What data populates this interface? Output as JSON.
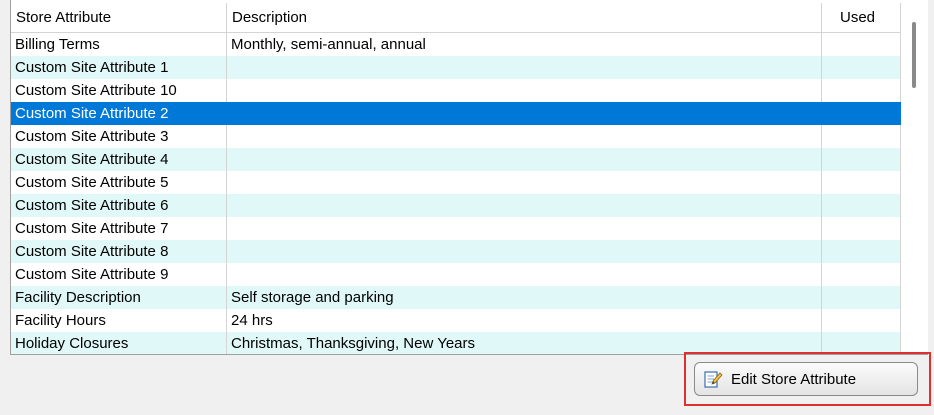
{
  "grid": {
    "columns": [
      "Store Attribute",
      "Description",
      "Used"
    ],
    "rows": [
      {
        "attribute": "Billing Terms",
        "description": "Monthly, semi-annual, annual",
        "used": ""
      },
      {
        "attribute": "Custom Site Attribute 1",
        "description": "",
        "used": ""
      },
      {
        "attribute": "Custom Site Attribute 10",
        "description": "",
        "used": ""
      },
      {
        "attribute": "Custom Site Attribute 2",
        "description": "",
        "used": "",
        "selected": true
      },
      {
        "attribute": "Custom Site Attribute 3",
        "description": "",
        "used": ""
      },
      {
        "attribute": "Custom Site Attribute 4",
        "description": "",
        "used": ""
      },
      {
        "attribute": "Custom Site Attribute 5",
        "description": "",
        "used": ""
      },
      {
        "attribute": "Custom Site Attribute 6",
        "description": "",
        "used": ""
      },
      {
        "attribute": "Custom Site Attribute 7",
        "description": "",
        "used": ""
      },
      {
        "attribute": "Custom Site Attribute 8",
        "description": "",
        "used": ""
      },
      {
        "attribute": "Custom Site Attribute 9",
        "description": "",
        "used": ""
      },
      {
        "attribute": "Facility Description",
        "description": "Self storage and parking",
        "used": ""
      },
      {
        "attribute": "Facility Hours",
        "description": "24 hrs",
        "used": ""
      },
      {
        "attribute": "Holiday Closures",
        "description": "Christmas, Thanksgiving, New Years",
        "used": ""
      }
    ]
  },
  "edit_button": {
    "label": "Edit Store Attribute",
    "icon": "edit-document-icon"
  },
  "colors": {
    "selection": "#0078d7",
    "alt_row": "#e0f8f8",
    "highlight_border": "#e0302e"
  }
}
